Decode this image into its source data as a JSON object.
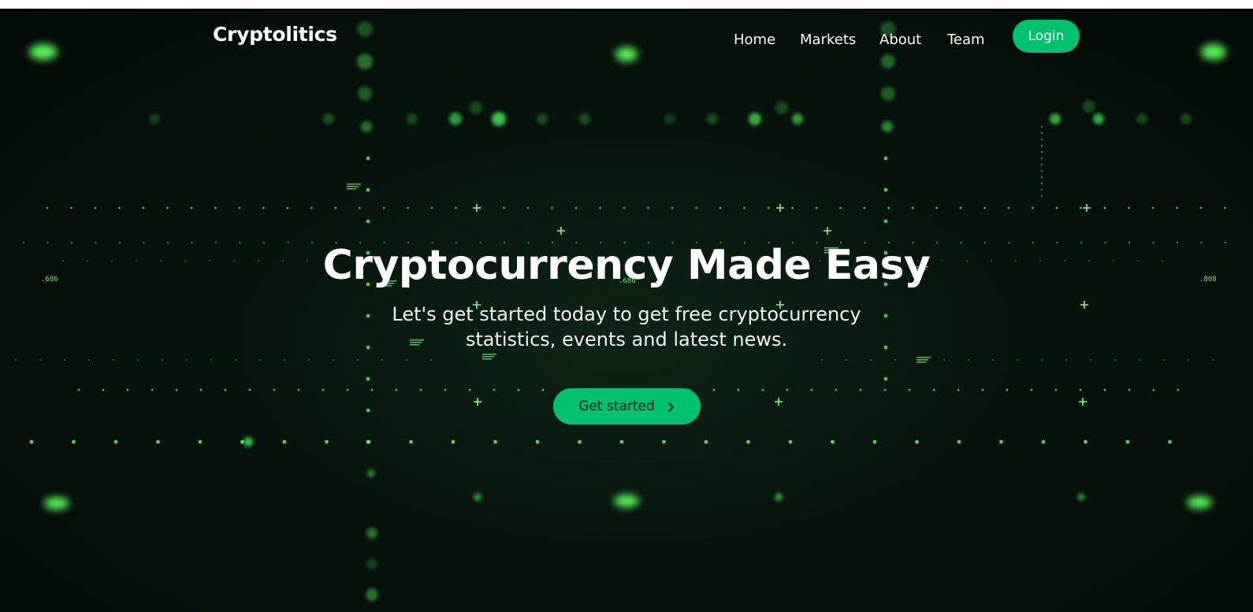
{
  "brand": {
    "name": "Cryptolitics"
  },
  "nav": {
    "items": [
      {
        "label": "Home"
      },
      {
        "label": "Markets"
      },
      {
        "label": "About"
      },
      {
        "label": "Team"
      }
    ],
    "login_label": "Login"
  },
  "hero": {
    "title": "Cryptocurrency Made Easy",
    "subtitle": "Let's get started today to get free cryptocurrency statistics, events and latest news.",
    "cta_label": "Get started",
    "cta_icon": "chevron-right-icon"
  },
  "background": {
    "digit_labels": [
      ".686",
      ".686",
      ".808"
    ]
  },
  "colors": {
    "accent": "#00c26e",
    "glow": "#5dff5d",
    "background": "#07140d",
    "text": "#ffffff"
  }
}
